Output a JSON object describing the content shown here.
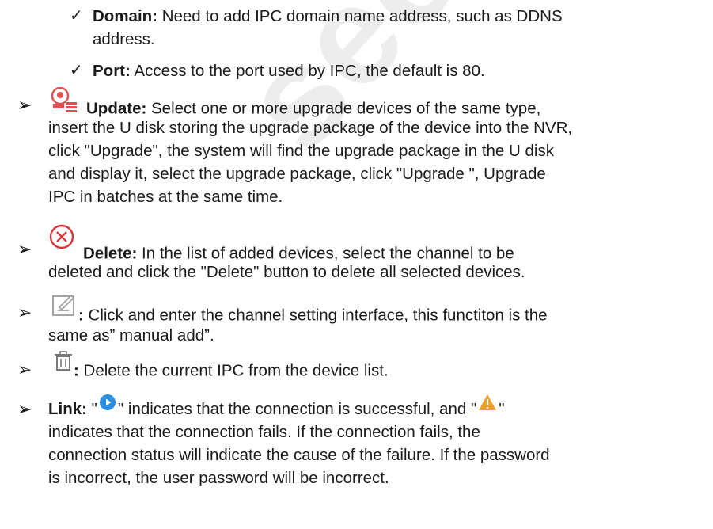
{
  "watermark": "security.com",
  "symbols": {
    "check": "✓",
    "arrow": "➢"
  },
  "domain_item": {
    "term": "Domain:",
    "line1": " Need to add IPC domain name address, such as DDNS",
    "line2": "address."
  },
  "port_item": {
    "term": "Port:",
    "line1": " Access to the port used by IPC, the default is 80."
  },
  "update_item": {
    "icon": "update-icon",
    "term": "Update:",
    "line1": " Select one or more upgrade devices of the same type,",
    "line2": "insert the U disk storing the upgrade package of the device into the NVR,",
    "line3": "click \"Upgrade\", the system will find the upgrade package in the U disk",
    "line4": "and display it, select the upgrade package, click \"Upgrade \", Upgrade",
    "line5": "IPC in batches at the same time."
  },
  "delete_item": {
    "icon": "delete-circle-icon",
    "term": "Delete:",
    "line1": " In the list of added devices, select the channel to be",
    "line2": "deleted and click the \"Delete\" button to delete all selected devices."
  },
  "edit_item": {
    "icon": "edit-icon",
    "term": ":",
    "line1": " Click and enter the channel setting interface, this functiton is the",
    "line2": "same as” manual add”."
  },
  "trash_item": {
    "icon": "trash-icon",
    "term": ":",
    "line1": " Delete the current IPC from the device list."
  },
  "link_item": {
    "term": "Link:",
    "part1": " \"",
    "part2": "\" indicates that the connection is successful, and \"",
    "part3": "\"",
    "success_icon": "play-circle-icon",
    "fail_icon": "warning-icon",
    "line2": "indicates that the connection fails. If the connection fails, the",
    "line3": "connection status will indicate the cause of the failure. If the password",
    "line4": "is incorrect, the user password will be incorrect."
  },
  "colors": {
    "update_red": "#e05050",
    "delete_red": "#d8353a",
    "play_blue": "#2b8ee0",
    "warning_orange": "#f0a020"
  }
}
